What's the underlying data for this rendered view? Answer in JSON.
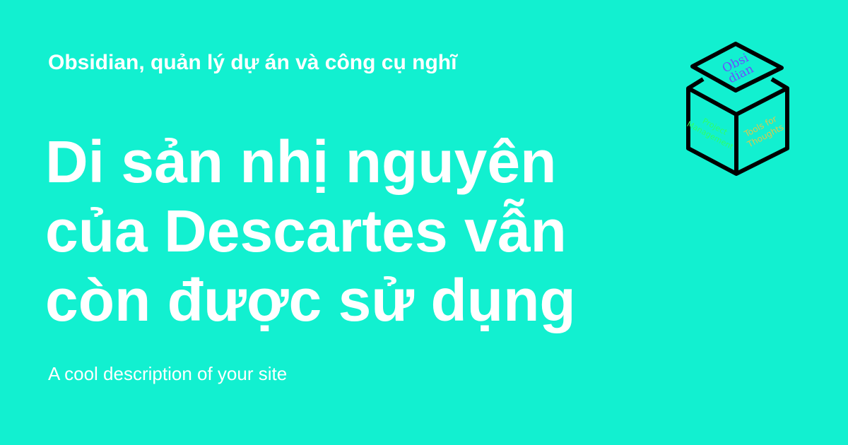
{
  "colors": {
    "background": "#12F0D0",
    "text": "#ffffff",
    "logo_stroke": "#000000",
    "logo_top_text": "#6a4cff",
    "logo_left_text": "#2eff66",
    "logo_right_text": "#e0c84a"
  },
  "header": {
    "site_name": "Obsidian, quản lý dự án và công cụ nghĩ"
  },
  "main": {
    "title": "Di sản nhị nguyên của Descartes vẫn còn được sử dụng",
    "description": "A cool description of your site"
  },
  "logo": {
    "icon": "cube-logo-icon",
    "top_line1": "Obsi",
    "top_line2": "dian",
    "left_line1": "Project",
    "left_line2": "Management",
    "right_line1": "Tools for",
    "right_line2": "Thoughts"
  }
}
